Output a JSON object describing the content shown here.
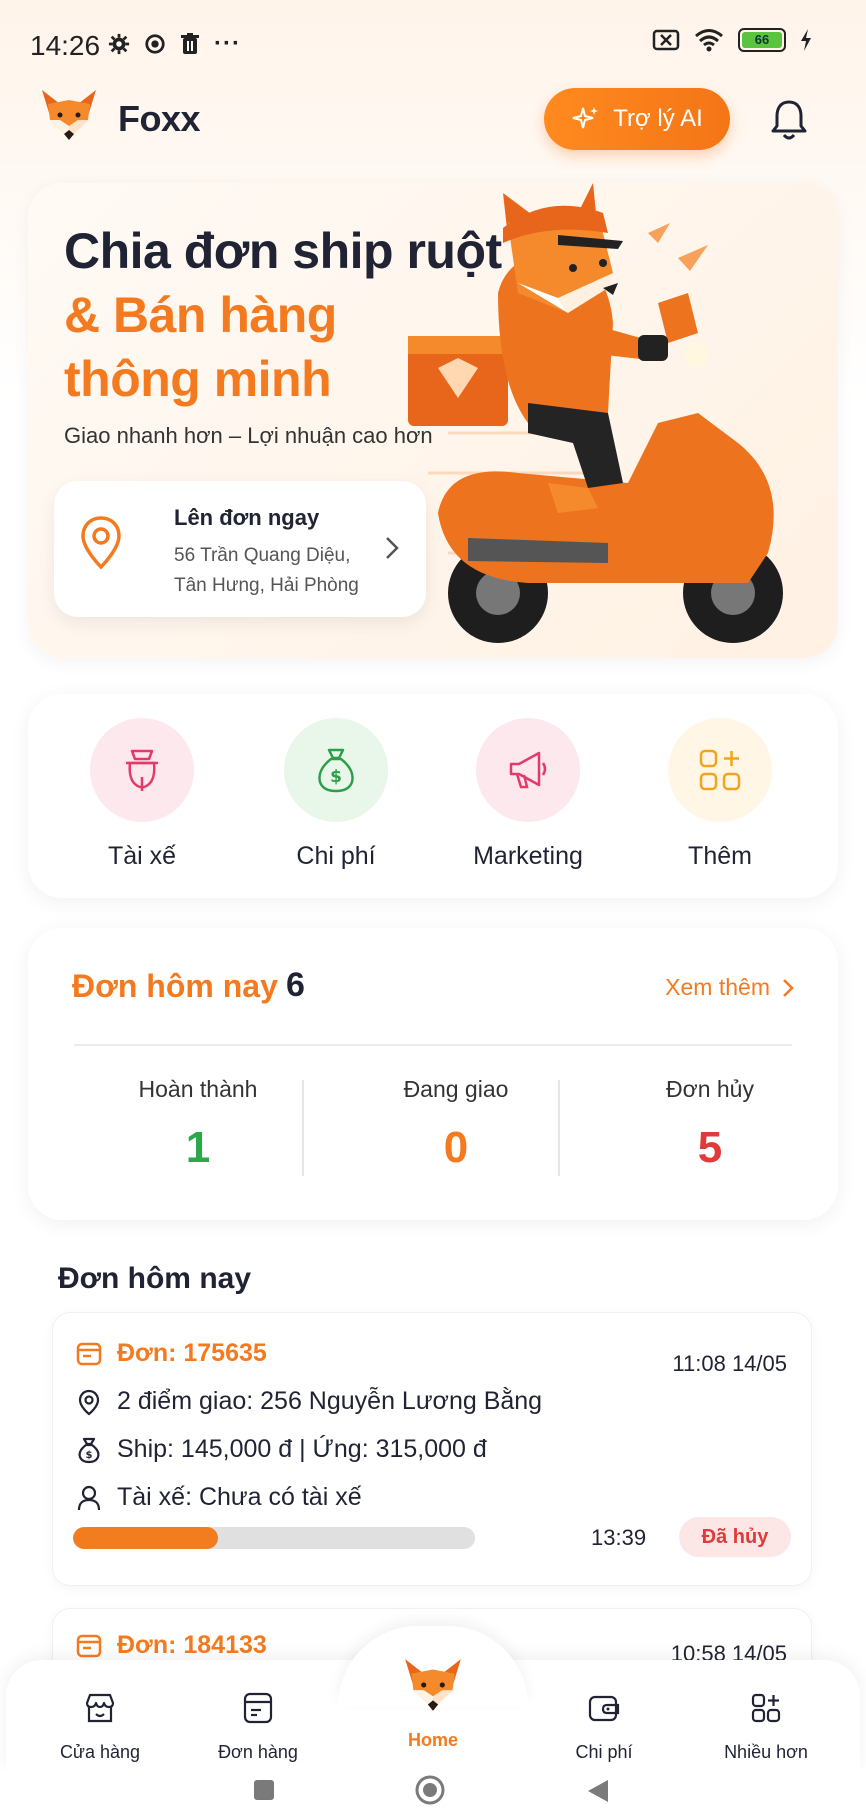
{
  "status_bar": {
    "time": "14:26",
    "more": "···",
    "battery_level": "66",
    "icons_left": [
      "gear-icon",
      "shield-icon",
      "trash-icon",
      "more-icon"
    ],
    "icons_right": [
      "sim-off-icon",
      "wifi-icon",
      "battery-icon",
      "charging-icon"
    ]
  },
  "header": {
    "brand": "Foxx",
    "ai_button_label": "Trợ lý AI",
    "notification_icon": "bell-icon"
  },
  "banner": {
    "title_line1": "Chia đơn ship ruột",
    "title_line2": "& Bán hàng",
    "title_line3": "thông minh",
    "subtitle": "Giao nhanh hơn – Lợi nhuận cao hơn",
    "order_card": {
      "title": "Lên đơn ngay",
      "address_line1": "56 Trần Quang Diệu,",
      "address_line2": "Tân Hưng, Hải Phòng"
    }
  },
  "quick_actions": [
    {
      "label": "Tài xế",
      "icon": "scooter-icon",
      "bg": "#fde8ee",
      "color": "#e5396a"
    },
    {
      "label": "Chi phí",
      "icon": "money-bag-icon",
      "bg": "#e9f7ea",
      "color": "#2e9e48"
    },
    {
      "label": "Marketing",
      "icon": "megaphone-icon",
      "bg": "#fde8ee",
      "color": "#e5396a"
    },
    {
      "label": "Thêm",
      "icon": "grid-plus-icon",
      "bg": "#fff6e6",
      "color": "#f4a31f"
    }
  ],
  "today_stats": {
    "title": "Đơn hôm nay",
    "count": "6",
    "see_more": "Xem thêm",
    "items": [
      {
        "label": "Hoàn thành",
        "value": "1",
        "color": "#2aa84a"
      },
      {
        "label": "Đang giao",
        "value": "0",
        "color": "#f47a1f"
      },
      {
        "label": "Đơn hủy",
        "value": "5",
        "color": "#e03a3a"
      }
    ]
  },
  "orders_section": {
    "title": "Đơn hôm nay",
    "orders": [
      {
        "id": "Đơn: 175635",
        "datetime": "11:08 14/05",
        "delivery": "2 điểm giao: 256 Nguyễn Lương Bằng",
        "fees": "Ship: 145,000 đ  | Ứng: 315,000 đ",
        "driver": "Tài xế: Chưa có tài xế",
        "progress": 0.36,
        "time": "13:39",
        "status": "Đã hủy"
      },
      {
        "id": "Đơn: 184133",
        "datetime": "10:58 14/05"
      }
    ]
  },
  "bottom_nav": [
    {
      "label": "Cửa hàng",
      "icon": "store-icon"
    },
    {
      "label": "Đơn hàng",
      "icon": "orders-icon"
    },
    {
      "label": "Home",
      "icon": "fox-logo-icon",
      "active": true
    },
    {
      "label": "Chi phí",
      "icon": "wallet-icon"
    },
    {
      "label": "Nhiều hơn",
      "icon": "grid-plus-icon"
    }
  ],
  "colors": {
    "accent": "#f47a1f",
    "success": "#2aa84a",
    "danger": "#e03a3a",
    "text": "#1f2333"
  }
}
